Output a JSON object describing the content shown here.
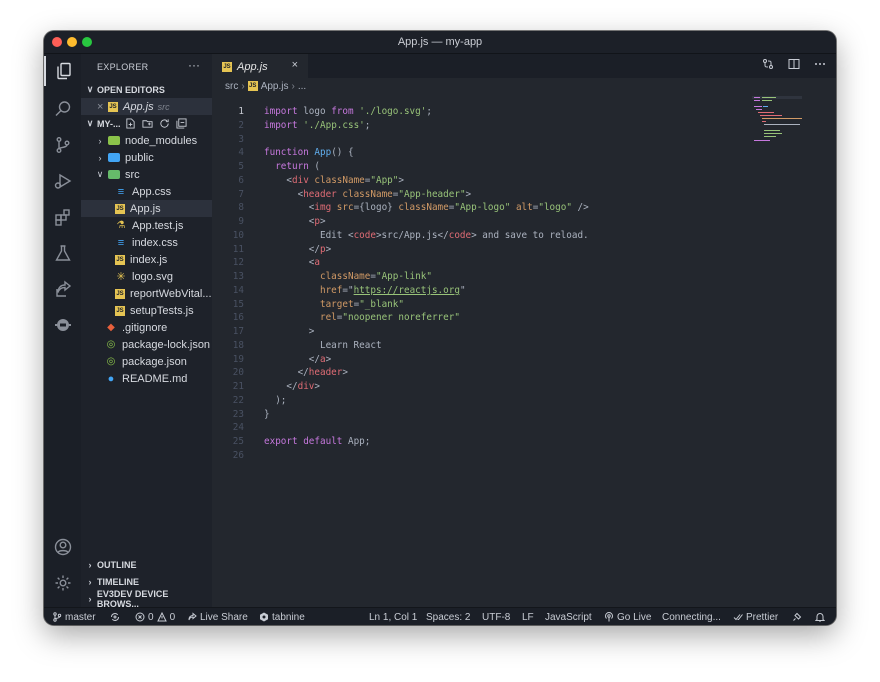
{
  "window": {
    "title": "App.js — my-app"
  },
  "explorer": {
    "title": "EXPLORER",
    "more": "···",
    "open_editors": {
      "label": "OPEN EDITORS",
      "items": [
        {
          "close": "×",
          "name": "App.js",
          "dir": "src"
        }
      ]
    },
    "project": {
      "label": "MY-..."
    },
    "tree": [
      {
        "name": "node_modules",
        "type": "folder",
        "chevron": ">",
        "depth": 0
      },
      {
        "name": "public",
        "type": "folder",
        "chevron": ">",
        "depth": 0
      },
      {
        "name": "src",
        "type": "folder",
        "chevron": "v",
        "depth": 0
      },
      {
        "name": "App.css",
        "type": "css",
        "depth": 1
      },
      {
        "name": "App.js",
        "type": "js",
        "depth": 1,
        "selected": true
      },
      {
        "name": "App.test.js",
        "type": "test",
        "depth": 1
      },
      {
        "name": "index.css",
        "type": "css",
        "depth": 1
      },
      {
        "name": "index.js",
        "type": "js",
        "depth": 1
      },
      {
        "name": "logo.svg",
        "type": "svg",
        "depth": 1
      },
      {
        "name": "reportWebVital...",
        "type": "js",
        "depth": 1
      },
      {
        "name": "setupTests.js",
        "type": "js",
        "depth": 1
      },
      {
        "name": ".gitignore",
        "type": "git",
        "depth": 0
      },
      {
        "name": "package-lock.json",
        "type": "json",
        "depth": 0
      },
      {
        "name": "package.json",
        "type": "json",
        "depth": 0
      },
      {
        "name": "README.md",
        "type": "info",
        "depth": 0
      }
    ],
    "bottom_sections": [
      "OUTLINE",
      "TIMELINE",
      "EV3DEV DEVICE BROWS..."
    ]
  },
  "tab": {
    "name": "App.js",
    "close": "×"
  },
  "breadcrumb": {
    "folder": "src",
    "file": "App.js",
    "symbol": "..."
  },
  "editor": {
    "current_line": 1,
    "lines": [
      [
        {
          "t": "import",
          "c": "kw"
        },
        {
          "t": " logo "
        },
        {
          "t": "from",
          "c": "kw"
        },
        {
          "t": " "
        },
        {
          "t": "'./logo.svg'",
          "c": "str"
        },
        {
          "t": ";"
        }
      ],
      [
        {
          "t": "import",
          "c": "kw"
        },
        {
          "t": " "
        },
        {
          "t": "'./App.css'",
          "c": "str"
        },
        {
          "t": ";"
        }
      ],
      [],
      [
        {
          "t": "function",
          "c": "kw"
        },
        {
          "t": " "
        },
        {
          "t": "App",
          "c": "fn"
        },
        {
          "t": "() {"
        }
      ],
      [
        {
          "t": "  "
        },
        {
          "t": "return",
          "c": "kw"
        },
        {
          "t": " ("
        }
      ],
      [
        {
          "t": "    <"
        },
        {
          "t": "div",
          "c": "tag"
        },
        {
          "t": " "
        },
        {
          "t": "className",
          "c": "attr"
        },
        {
          "t": "="
        },
        {
          "t": "\"App\"",
          "c": "str"
        },
        {
          "t": ">"
        }
      ],
      [
        {
          "t": "      <"
        },
        {
          "t": "header",
          "c": "tag"
        },
        {
          "t": " "
        },
        {
          "t": "className",
          "c": "attr"
        },
        {
          "t": "="
        },
        {
          "t": "\"App-header\"",
          "c": "str"
        },
        {
          "t": ">"
        }
      ],
      [
        {
          "t": "        <"
        },
        {
          "t": "img",
          "c": "tag"
        },
        {
          "t": " "
        },
        {
          "t": "src",
          "c": "attr"
        },
        {
          "t": "={logo} "
        },
        {
          "t": "className",
          "c": "attr"
        },
        {
          "t": "="
        },
        {
          "t": "\"App-logo\"",
          "c": "str"
        },
        {
          "t": " "
        },
        {
          "t": "alt",
          "c": "attr"
        },
        {
          "t": "="
        },
        {
          "t": "\"logo\"",
          "c": "str"
        },
        {
          "t": " />"
        }
      ],
      [
        {
          "t": "        <"
        },
        {
          "t": "p",
          "c": "tag"
        },
        {
          "t": ">"
        }
      ],
      [
        {
          "t": "          Edit <"
        },
        {
          "t": "code",
          "c": "tag"
        },
        {
          "t": ">src/App.js</"
        },
        {
          "t": "code",
          "c": "tag"
        },
        {
          "t": "> and save to reload."
        }
      ],
      [
        {
          "t": "        </"
        },
        {
          "t": "p",
          "c": "tag"
        },
        {
          "t": ">"
        }
      ],
      [
        {
          "t": "        <"
        },
        {
          "t": "a",
          "c": "tag"
        }
      ],
      [
        {
          "t": "          "
        },
        {
          "t": "className",
          "c": "attr"
        },
        {
          "t": "="
        },
        {
          "t": "\"App-link\"",
          "c": "str"
        }
      ],
      [
        {
          "t": "          "
        },
        {
          "t": "href",
          "c": "attr"
        },
        {
          "t": "="
        },
        {
          "t": "\""
        },
        {
          "t": "https://reactjs.org",
          "c": "lnk"
        },
        {
          "t": "\""
        }
      ],
      [
        {
          "t": "          "
        },
        {
          "t": "target",
          "c": "attr"
        },
        {
          "t": "="
        },
        {
          "t": "\"_blank\"",
          "c": "str"
        }
      ],
      [
        {
          "t": "          "
        },
        {
          "t": "rel",
          "c": "attr"
        },
        {
          "t": "="
        },
        {
          "t": "\"noopener noreferrer\"",
          "c": "str"
        }
      ],
      [
        {
          "t": "        >"
        }
      ],
      [
        {
          "t": "          Learn React"
        }
      ],
      [
        {
          "t": "        </"
        },
        {
          "t": "a",
          "c": "tag"
        },
        {
          "t": ">"
        }
      ],
      [
        {
          "t": "      </"
        },
        {
          "t": "header",
          "c": "tag"
        },
        {
          "t": ">"
        }
      ],
      [
        {
          "t": "    </"
        },
        {
          "t": "div",
          "c": "tag"
        },
        {
          "t": ">"
        }
      ],
      [
        {
          "t": "  );"
        }
      ],
      [
        {
          "t": "}"
        }
      ],
      [],
      [
        {
          "t": "export",
          "c": "kw"
        },
        {
          "t": " "
        },
        {
          "t": "default",
          "c": "kw"
        },
        {
          "t": " App;"
        }
      ],
      []
    ]
  },
  "status": {
    "branch": "master",
    "errors": "0",
    "warnings": "0",
    "live_share": "Live Share",
    "tabnine": "tabnine",
    "position": "Ln 1, Col 1",
    "spaces": "Spaces: 2",
    "encoding": "UTF-8",
    "eol": "LF",
    "language": "JavaScript",
    "go_live": "Go Live",
    "connecting": "Connecting...",
    "prettier": "Prettier"
  },
  "colors": {
    "background": "#23272e",
    "sidebar": "#1e222a",
    "keyword": "#c678dd",
    "string": "#98c379",
    "function": "#61afef",
    "tag": "#e06c75",
    "attribute": "#d19a66",
    "js_icon": "#e5c453"
  }
}
